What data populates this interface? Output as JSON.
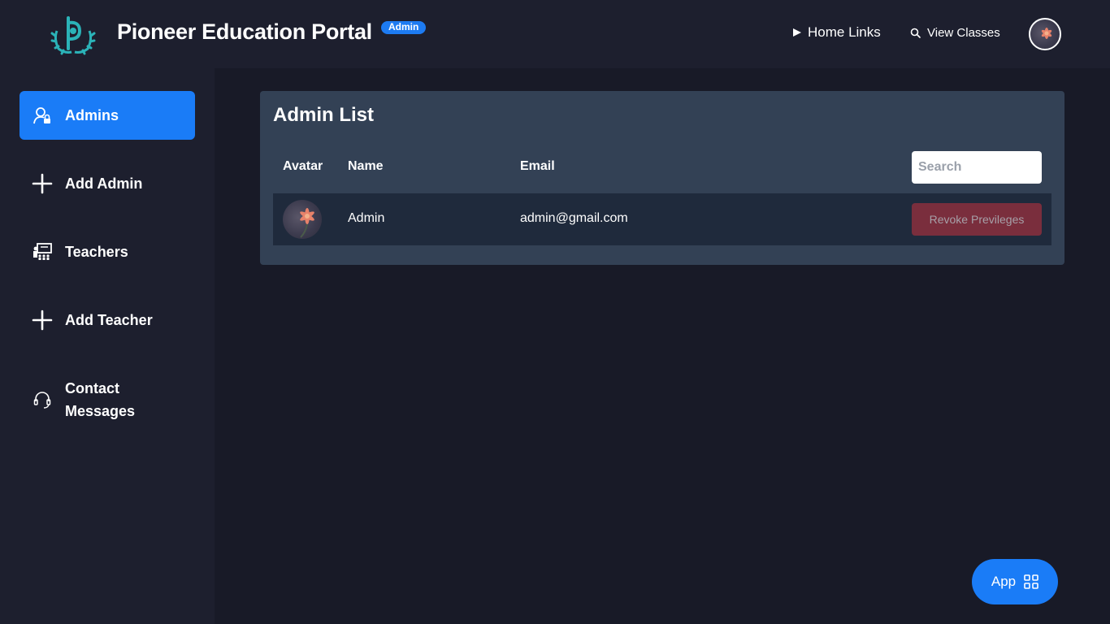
{
  "header": {
    "title": "Pioneer Education Portal",
    "badge": "Admin",
    "nav": {
      "home_links": "Home Links",
      "view_classes": "View Classes"
    }
  },
  "sidebar": {
    "items": [
      {
        "label": "Admins",
        "icon": "user-lock-icon",
        "active": true
      },
      {
        "label": "Add Admin",
        "icon": "plus-icon"
      },
      {
        "label": "Teachers",
        "icon": "teacher-board-icon"
      },
      {
        "label": "Add Teacher",
        "icon": "plus-icon"
      },
      {
        "label": "Contact Messages",
        "icon": "headset-icon"
      }
    ]
  },
  "main": {
    "title": "Admin List",
    "columns": [
      "Avatar",
      "Name",
      "Email"
    ],
    "search_placeholder": "Search",
    "rows": [
      {
        "name": "Admin",
        "email": "admin@gmail.com",
        "action": "Revoke Previleges"
      }
    ]
  },
  "fab": {
    "label": "App",
    "icon": "grid-icon"
  },
  "colors": {
    "accent": "#1a7cf7",
    "background": "#181a27",
    "panel": "#1d1f2e",
    "card": "#334155",
    "danger_muted": "#7a2e3d",
    "logo": "#2bb3b8"
  }
}
